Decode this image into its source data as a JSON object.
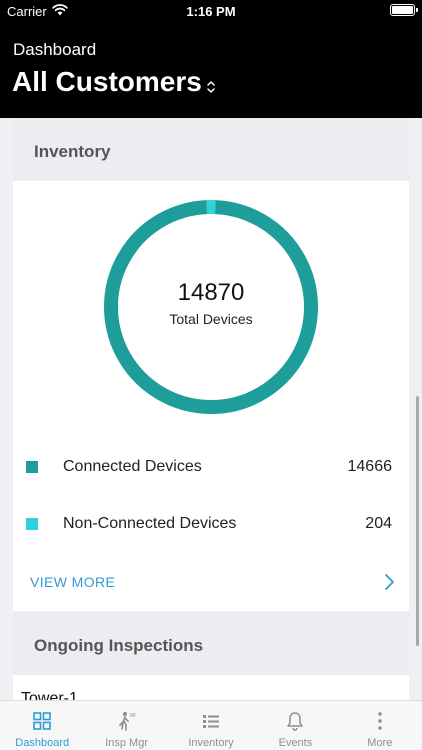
{
  "status_bar": {
    "carrier": "Carrier",
    "time": "1:16 PM"
  },
  "header": {
    "subtitle": "Dashboard",
    "title": "All Customers"
  },
  "inventory_card": {
    "title": "Inventory",
    "total_value": "14870",
    "total_label": "Total Devices",
    "legend": [
      {
        "label": "Connected Devices",
        "value": "14666",
        "color": "#1d9e9a"
      },
      {
        "label": "Non-Connected Devices",
        "value": "204",
        "color": "#2ed3d6"
      }
    ],
    "view_more_label": "VIEW MORE"
  },
  "chart_data": {
    "type": "pie",
    "categories": [
      "Connected Devices",
      "Non-Connected Devices"
    ],
    "values": [
      14666,
      204
    ],
    "colors": [
      "#1d9e9a",
      "#2ed3d6"
    ],
    "donut": true,
    "center_text": "14870",
    "center_label": "Total Devices"
  },
  "inspections_card": {
    "title": "Ongoing Inspections",
    "first_row": "Tower-1"
  },
  "tabbar": {
    "items": [
      {
        "label": "Dashboard",
        "icon": "dashboard-grid-icon",
        "active": true
      },
      {
        "label": "Insp Mgr",
        "icon": "inspector-walk-icon",
        "active": false
      },
      {
        "label": "Inventory",
        "icon": "inventory-list-icon",
        "active": false
      },
      {
        "label": "Events",
        "icon": "bell-icon",
        "active": false
      },
      {
        "label": "More",
        "icon": "more-vertical-icon",
        "active": false
      }
    ]
  },
  "colors": {
    "accent": "#2e9bd6",
    "connected": "#1d9e9a",
    "non_connected": "#2ed3d6"
  }
}
